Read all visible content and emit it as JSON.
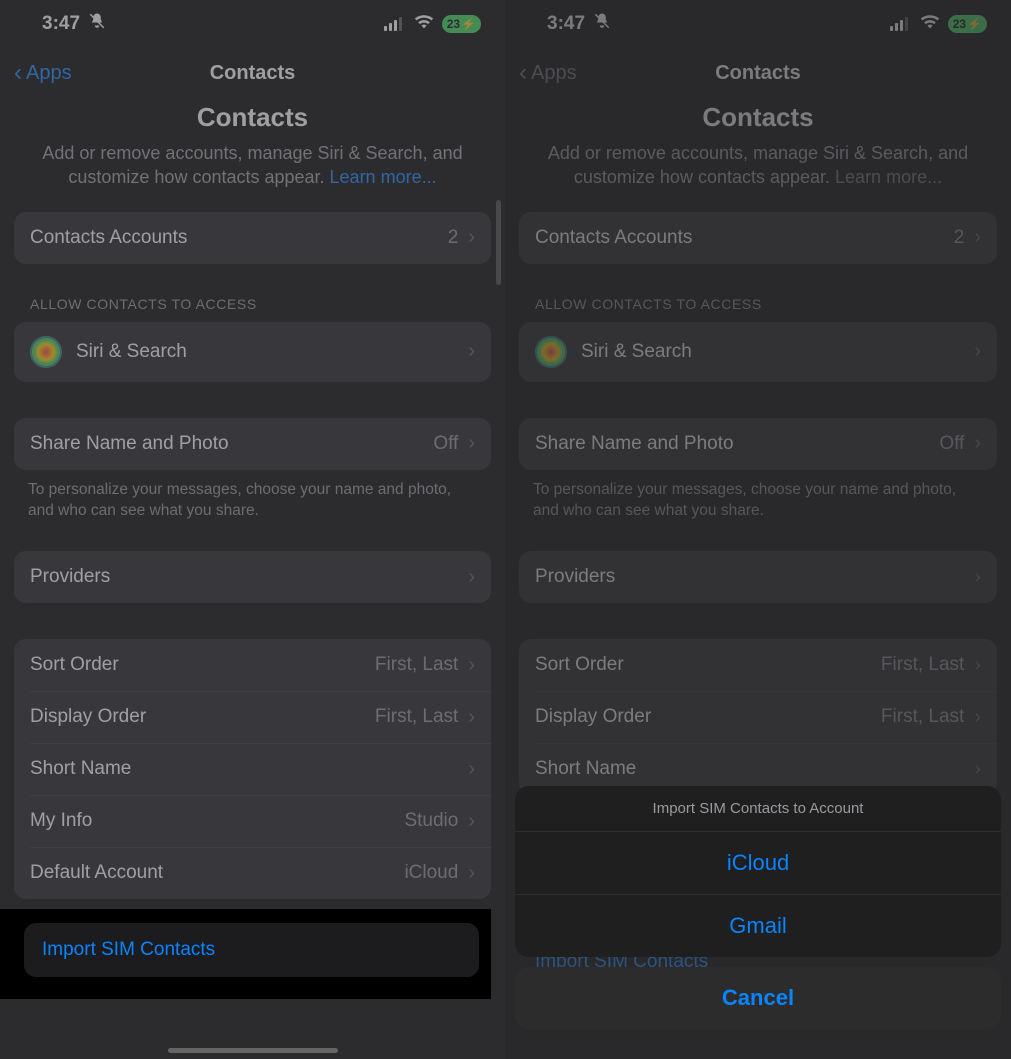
{
  "status": {
    "time": "3:47",
    "battery": "23",
    "battery_charging_glyph": "⚡"
  },
  "nav": {
    "back_label": "Apps",
    "title": "Contacts"
  },
  "header": {
    "title": "Contacts",
    "desc_a": "Add or remove accounts, manage Siri & Search, and customize how contacts appear. ",
    "learn_more": "Learn more..."
  },
  "rows": {
    "contacts_accounts": {
      "label": "Contacts Accounts",
      "value": "2"
    },
    "siri": {
      "label": "Siri & Search"
    },
    "share": {
      "label": "Share Name and Photo",
      "value": "Off"
    },
    "providers": {
      "label": "Providers"
    },
    "sort": {
      "label": "Sort Order",
      "value": "First, Last"
    },
    "display": {
      "label": "Display Order",
      "value": "First, Last"
    },
    "short": {
      "label": "Short Name"
    },
    "myinfo": {
      "label": "My Info",
      "value": "Studio"
    },
    "default_acct": {
      "label": "Default Account",
      "value": "iCloud"
    },
    "import_sim": {
      "label": "Import SIM Contacts"
    }
  },
  "sections": {
    "allow": "ALLOW CONTACTS TO ACCESS",
    "share_footer": "To personalize your messages, choose your name and photo, and who can see what you share."
  },
  "sheet": {
    "title": "Import SIM Contacts to Account",
    "opt1": "iCloud",
    "opt2": "Gmail",
    "cancel": "Cancel"
  }
}
